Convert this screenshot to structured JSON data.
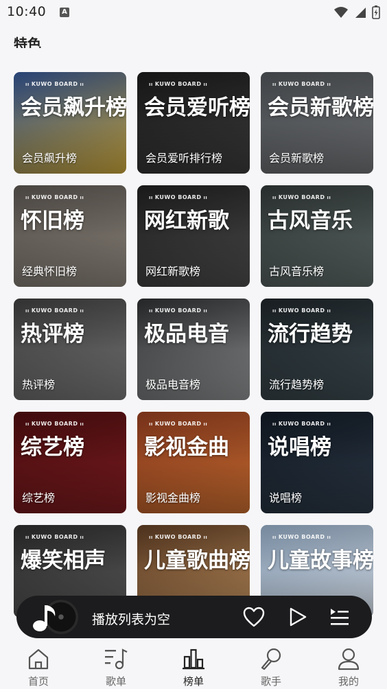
{
  "status_bar": {
    "time": "10:40",
    "badge": "A"
  },
  "section": {
    "title": "特色"
  },
  "cards": [
    {
      "big": "会员飙升榜",
      "caption": "会员飙升榜",
      "brand": "KUWO BOARD",
      "colors": [
        "#2f4f8a",
        "#c8a43a"
      ]
    },
    {
      "big": "会员爱听榜",
      "caption": "会员爱听排行榜",
      "brand": "KUWO BOARD",
      "colors": [
        "#1a1a1a",
        "#3a3a3a"
      ]
    },
    {
      "big": "会员新歌榜",
      "caption": "会员新歌榜",
      "brand": "KUWO BOARD",
      "colors": [
        "#4a4e52",
        "#6d6f72"
      ]
    },
    {
      "big": "怀旧榜",
      "caption": "经典怀旧榜",
      "brand": "KUWO BOARD",
      "colors": [
        "#55504b",
        "#8a837a"
      ]
    },
    {
      "big": "网红新歌",
      "caption": "网红新歌榜",
      "brand": "KUWO BOARD",
      "colors": [
        "#1e1e1e",
        "#4a4a4a"
      ]
    },
    {
      "big": "古风音乐",
      "caption": "古风音乐榜",
      "brand": "KUWO BOARD",
      "colors": [
        "#2e3534",
        "#5c6866"
      ]
    },
    {
      "big": "热评榜",
      "caption": "热评榜",
      "brand": "KUWO BOARD",
      "colors": [
        "#3a3a3a",
        "#777777"
      ]
    },
    {
      "big": "极品电音",
      "caption": "极品电音榜",
      "brand": "KUWO BOARD",
      "colors": [
        "#2a2c2e",
        "#8d8f90"
      ]
    },
    {
      "big": "流行趋势",
      "caption": "流行趋势榜",
      "brand": "KUWO BOARD",
      "colors": [
        "#1c2226",
        "#3c4a50"
      ]
    },
    {
      "big": "综艺榜",
      "caption": "综艺榜",
      "brand": "KUWO BOARD",
      "colors": [
        "#4a0d0f",
        "#7a1b1f"
      ]
    },
    {
      "big": "影视金曲",
      "caption": "影视金曲榜",
      "brand": "KUWO BOARD",
      "colors": [
        "#8a3a1e",
        "#c46a2e"
      ]
    },
    {
      "big": "说唱榜",
      "caption": "说唱榜",
      "brand": "KUWO BOARD",
      "colors": [
        "#101822",
        "#2c3846"
      ]
    },
    {
      "big": "爆笑相声",
      "caption": "",
      "brand": "KUWO BOARD",
      "colors": [
        "#2a2a2a",
        "#5a5a5a"
      ]
    },
    {
      "big": "儿童歌曲榜",
      "caption": "",
      "brand": "KUWO BOARD",
      "colors": [
        "#5a3a22",
        "#b88a5a"
      ]
    },
    {
      "big": "儿童故事榜",
      "caption": "",
      "brand": "KUWO BOARD",
      "colors": [
        "#8aa0b8",
        "#cfd8e3"
      ]
    }
  ],
  "player": {
    "status": "播放列表为空"
  },
  "nav": {
    "items": [
      {
        "label": "首页",
        "icon": "home-icon"
      },
      {
        "label": "歌单",
        "icon": "playlist-icon"
      },
      {
        "label": "榜单",
        "icon": "chart-icon",
        "active": true
      },
      {
        "label": "歌手",
        "icon": "singer-icon"
      },
      {
        "label": "我的",
        "icon": "profile-icon"
      }
    ]
  }
}
